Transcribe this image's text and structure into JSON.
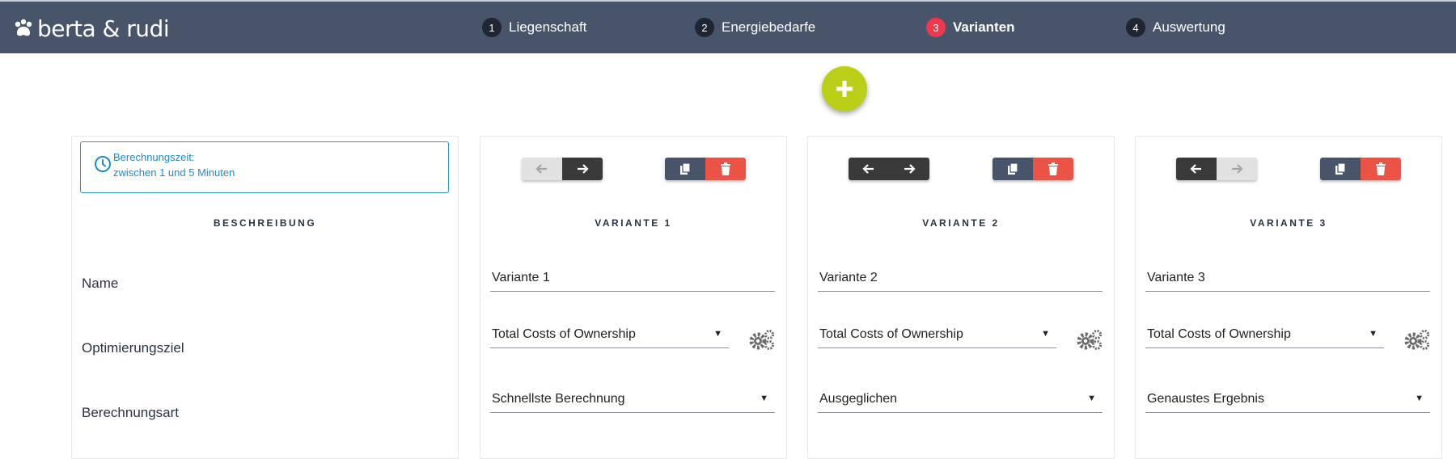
{
  "app": {
    "logo_text": "berta & rudi"
  },
  "steps": [
    {
      "num": "1",
      "label": "Liegenschaft",
      "active": false
    },
    {
      "num": "2",
      "label": "Energiebedarfe",
      "active": false
    },
    {
      "num": "3",
      "label": "Varianten",
      "active": true
    },
    {
      "num": "4",
      "label": "Auswertung",
      "active": false
    }
  ],
  "info": {
    "line1": "Berechnungszeit:",
    "line2": "zwischen 1 und 5 Minuten"
  },
  "description": {
    "title": "BESCHREIBUNG",
    "labels": {
      "name": "Name",
      "goal": "Optimierungsziel",
      "method": "Berechnungsart"
    }
  },
  "variants": [
    {
      "title": "VARIANTE 1",
      "name": "Variante 1",
      "goal": "Total Costs of Ownership",
      "method": "Schnellste Berechnung",
      "prev_enabled": false,
      "next_enabled": true
    },
    {
      "title": "VARIANTE 2",
      "name": "Variante 2",
      "goal": "Total Costs of Ownership",
      "method": "Ausgeglichen",
      "prev_enabled": true,
      "next_enabled": true
    },
    {
      "title": "VARIANTE 3",
      "name": "Variante 3",
      "goal": "Total Costs of Ownership",
      "method": "Genaustes Ergebnis",
      "prev_enabled": true,
      "next_enabled": false
    }
  ],
  "colors": {
    "header": "#475469",
    "active_step": "#f0384d",
    "fab": "#bccf18",
    "delete": "#eb5345",
    "info": "#1e8ad0"
  },
  "icons": {
    "add": "plus-icon",
    "prev": "arrow-left-icon",
    "next": "arrow-right-icon",
    "copy": "copy-icon",
    "delete": "trash-icon",
    "settings": "gears-icon",
    "time": "clock-icon"
  }
}
